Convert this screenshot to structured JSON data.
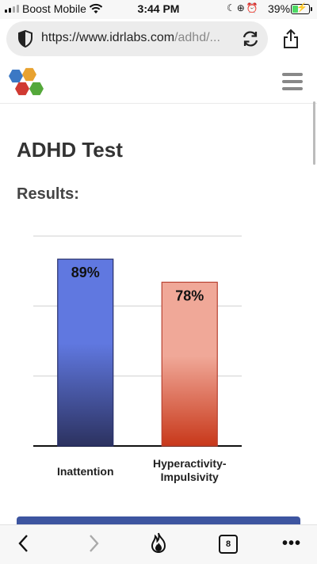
{
  "status_bar": {
    "carrier": "Boost Mobile",
    "time": "3:44 PM",
    "battery_percent": "39%",
    "battery_level": 0.39
  },
  "browser": {
    "url_host": "https://www.idrlabs.com",
    "url_path": "/adhd/...",
    "tab_count": "8"
  },
  "page": {
    "title": "ADHD Test",
    "subtitle": "Results:"
  },
  "chart_data": {
    "type": "bar",
    "categories": [
      "Inattention",
      "Hyperactivity-Impulsivity"
    ],
    "category_lines": [
      [
        "Inattention"
      ],
      [
        "Hyperactivity-",
        "Impulsivity"
      ]
    ],
    "values": [
      89,
      78
    ],
    "value_labels": [
      "89%",
      "78%"
    ],
    "ylim": [
      0,
      100
    ],
    "gridlines": [
      0,
      33.3,
      66.7,
      100
    ],
    "colors": [
      {
        "top": "#6078e0",
        "bottom": "#2c3260",
        "stroke": "#27306a"
      },
      {
        "top": "#f0a898",
        "bottom": "#c8381a",
        "stroke": "#b84030"
      }
    ]
  }
}
